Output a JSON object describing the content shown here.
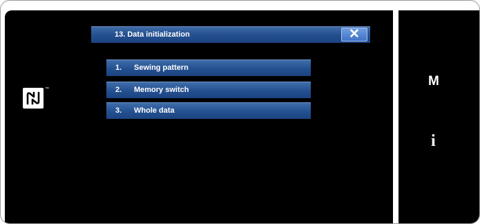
{
  "dialog": {
    "title": "13.  Data initialization",
    "close_glyph": "✕"
  },
  "menu": {
    "items": [
      {
        "num": "1.",
        "label": "Sewing pattern"
      },
      {
        "num": "2.",
        "label": "Memory switch"
      },
      {
        "num": "3.",
        "label": "Whole data"
      }
    ]
  },
  "side": {
    "mode_button": "M",
    "info_button": "i"
  },
  "nfc": {
    "trademark": "™"
  },
  "colors": {
    "panel_bg": "#000000",
    "button_blue": "#245090",
    "close_blue": "#3f73c4",
    "text": "#ffffff"
  },
  "icons": [
    "nfc-icon",
    "close-icon",
    "info-icon"
  ]
}
